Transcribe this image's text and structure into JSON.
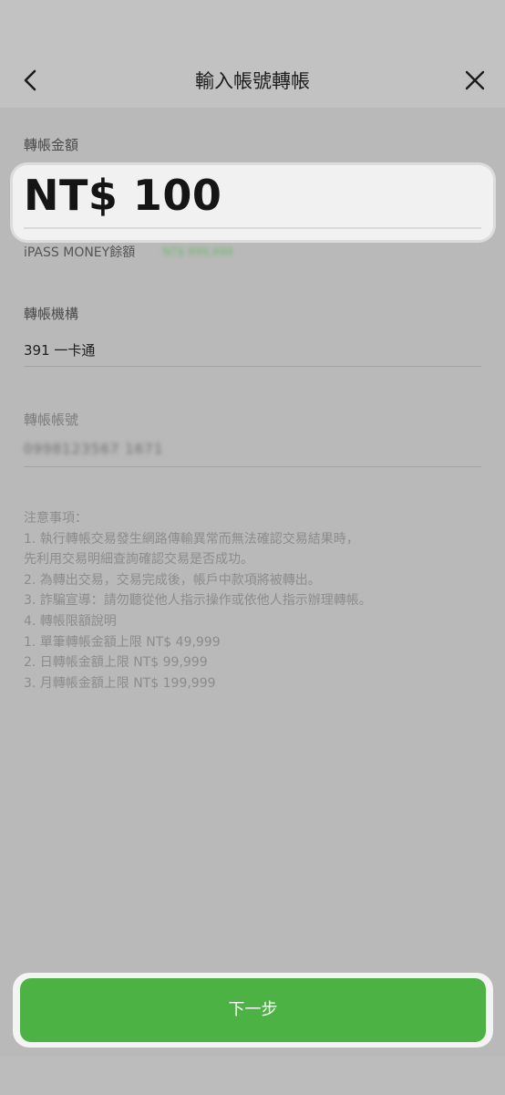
{
  "header": {
    "title": "輸入帳號轉帳",
    "back_icon": "chevron-left-icon",
    "close_icon": "close-icon"
  },
  "amount": {
    "label": "轉帳金額",
    "value": "NT$ 100",
    "balance_label": "iPASS MONEY餘額",
    "balance_value": "NT$ 999,999"
  },
  "institution": {
    "label": "轉帳機構",
    "value": "391 一卡通"
  },
  "account": {
    "label": "轉帳帳號",
    "value": "0998123567 1671"
  },
  "notes": [
    "注意事項：",
    "1. 執行轉帳交易發生網路傳輸異常而無法確認交易結果時，",
    "先利用交易明細查詢確認交易是否成功。",
    "2. 為轉出交易，交易完成後，帳戶中款項將被轉出。",
    "3. 詐騙宣導：請勿聽從他人指示操作或依他人指示辦理轉帳。",
    "4. 轉帳限額說明",
    "1. 單筆轉帳金額上限 NT$ 49,999",
    "2. 日轉帳金額上限 NT$ 99,999",
    "3. 月轉帳金額上限 NT$ 199,999"
  ],
  "next_button": {
    "label": "下一步"
  },
  "colors": {
    "primary_green": "#4cb244",
    "balance_green": "#6db86d"
  }
}
